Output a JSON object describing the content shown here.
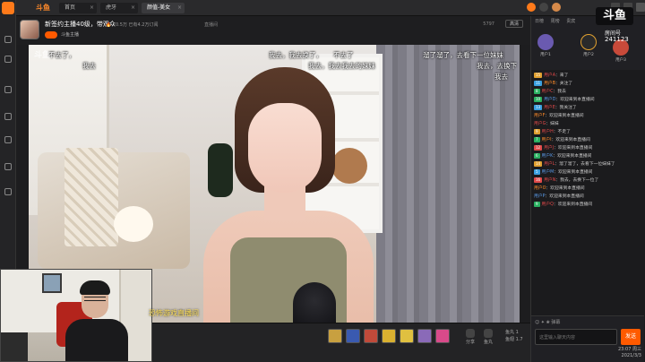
{
  "app": {
    "title": "斗鱼"
  },
  "tabs": [
    {
      "label": "首页"
    },
    {
      "label": "斗鱼"
    },
    {
      "label": "虎牙"
    },
    {
      "label": "颜值-美女",
      "active": true
    }
  ],
  "room": {
    "title": "新签约主播40级，带观众",
    "owner": "斗鱼主播",
    "stats": "🔥 10.5万  已有4.2万订阅",
    "mid": "直播间",
    "right": "5797",
    "quality": "高清"
  },
  "subtitles": [
    {
      "id": "s1",
      "text": "不去了，"
    },
    {
      "id": "s2",
      "text": "我去"
    },
    {
      "id": "s3",
      "text": "我去，我去换了，"
    },
    {
      "id": "s4",
      "text": "不去了"
    },
    {
      "id": "s5",
      "text": "我去，我去我去的妹妹"
    },
    {
      "id": "s6",
      "text": "溜了溜了，去看下一位妹妹"
    },
    {
      "id": "s7",
      "text": "我去，去换下"
    },
    {
      "id": "s8",
      "text": "我去"
    }
  ],
  "pip_subtitle": "恐怖游戏直播间",
  "video_logo": "斗鱼",
  "bottom_bar": {
    "icon1": "分享",
    "icon2": "鱼丸",
    "right1": "鱼丸 1",
    "right2": "鱼翅 1.7"
  },
  "chat": {
    "tabs": [
      "日榜",
      "周榜",
      "贵宾"
    ],
    "ranks": [
      {
        "name": "用户1"
      },
      {
        "name": "用户2"
      },
      {
        "name": "用户3"
      }
    ],
    "logo": "斗鱼",
    "fans_label": "房间号",
    "fans_count": "241123",
    "messages": [
      {
        "badge": "15",
        "badge_color": "#e0a030",
        "nick": "用户A",
        "nick_class": "red",
        "text": "：来了"
      },
      {
        "badge": "11",
        "badge_color": "#3aa0e0",
        "nick": "用户B",
        "nick_class": "org",
        "text": "：关注了"
      },
      {
        "badge": "8",
        "badge_color": "#2ab060",
        "nick": "用户C",
        "nick_class": "red",
        "text": "：我去"
      },
      {
        "badge": "10",
        "badge_color": "#2ab060",
        "nick": "用户D",
        "nick_class": "",
        "text": "：欢迎来到本直播间"
      },
      {
        "badge": "13",
        "badge_color": "#3aa0e0",
        "nick": "用户E",
        "nick_class": "red",
        "text": "：我关注了"
      },
      {
        "badge": "",
        "badge_color": "#888",
        "nick": "用户F",
        "nick_class": "org",
        "text": "：欢迎来到本直播间"
      },
      {
        "badge": "",
        "badge_color": "#888",
        "nick": "用户G",
        "nick_class": "red",
        "text": "：妹妹"
      },
      {
        "badge": "9",
        "badge_color": "#e0a030",
        "nick": "用户H",
        "nick_class": "red",
        "text": "：不走了"
      },
      {
        "badge": "7",
        "badge_color": "#2ab060",
        "nick": "用户I",
        "nick_class": "org",
        "text": "：欢迎来到本直播间"
      },
      {
        "badge": "12",
        "badge_color": "#e04a4a",
        "nick": "用户J",
        "nick_class": "red",
        "text": "：欢迎来到本直播间"
      },
      {
        "badge": "6",
        "badge_color": "#2ab060",
        "nick": "用户K",
        "nick_class": "",
        "text": "：欢迎来到本直播间"
      },
      {
        "badge": "14",
        "badge_color": "#e0a030",
        "nick": "用户L",
        "nick_class": "red",
        "text": "：溜了溜了，去看下一位妹妹了"
      },
      {
        "badge": "5",
        "badge_color": "#3aa0e0",
        "nick": "用户M",
        "nick_class": "",
        "text": "：欢迎来到本直播间"
      },
      {
        "badge": "16",
        "badge_color": "#e04a4a",
        "nick": "用户N",
        "nick_class": "red",
        "text": "：我去，去换下一位了"
      },
      {
        "badge": "",
        "badge_color": "#888",
        "nick": "用户O",
        "nick_class": "org",
        "text": "：欢迎来到本直播间"
      },
      {
        "badge": "",
        "badge_color": "#888",
        "nick": "用户P",
        "nick_class": "",
        "text": "：欢迎来到本直播间"
      },
      {
        "badge": "9",
        "badge_color": "#2ab060",
        "nick": "用户Q",
        "nick_class": "red",
        "text": "：欢迎来到本直播间"
      }
    ],
    "tools": "☺ ✦ ❀ 弹幕",
    "input_placeholder": "这里输入聊天内容",
    "send_label": "发送"
  },
  "clock": {
    "time": "23:07 周三",
    "date": "2021/3/3"
  },
  "colors": {
    "accent": "#ff5a00",
    "brand": "#ff7a1a"
  }
}
